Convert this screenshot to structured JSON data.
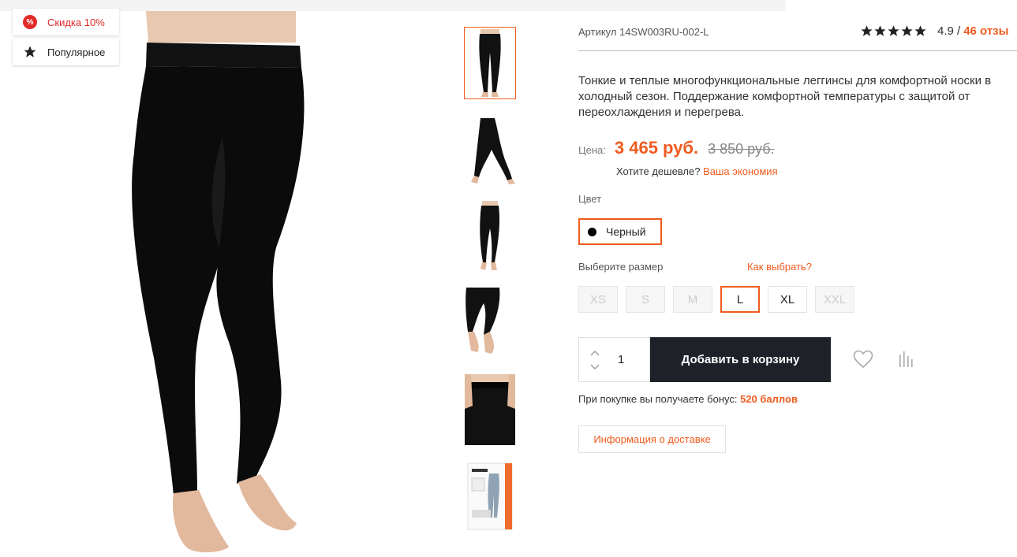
{
  "badges": {
    "discount": {
      "icon": "percent-icon",
      "label": "Скидка 10%",
      "icon_text": "%"
    },
    "popular": {
      "icon": "star-icon",
      "label": "Популярное"
    }
  },
  "product": {
    "article": "Артикул 14SW003RU-002-L",
    "rating": "4.9 /",
    "reviews": "46 отзы",
    "stars_filled": 5,
    "description": "Тонкие и теплые многофункциональные леггинсы для комфортной носки в холодный сезон. Поддержание комфортной температуры с защитой от переохлаждения и перегрева."
  },
  "price": {
    "label": "Цена:",
    "current": "3 465 руб.",
    "old": "3 850 руб.",
    "cheaper_text": "Хотите дешевле?",
    "cheaper_link": "Ваша экономия"
  },
  "color": {
    "label": "Цвет",
    "selected": "Черный"
  },
  "size": {
    "label": "Выберите размер",
    "help": "Как выбрать?",
    "options": [
      {
        "label": "XS",
        "state": "unavailable"
      },
      {
        "label": "S",
        "state": "unavailable"
      },
      {
        "label": "M",
        "state": "unavailable"
      },
      {
        "label": "L",
        "state": "selected"
      },
      {
        "label": "XL",
        "state": "available"
      },
      {
        "label": "XXL",
        "state": "unavailable"
      }
    ]
  },
  "cart": {
    "quantity": "1",
    "add_label": "Добавить в корзину"
  },
  "bonus": {
    "text": "При покупке вы получаете бонус:",
    "amount": "520 баллов"
  },
  "delivery_label": "Информация о доставке",
  "colors": {
    "accent": "#ef5b1e",
    "button_dark": "#1e2228",
    "discount_red": "#e02b2b"
  }
}
